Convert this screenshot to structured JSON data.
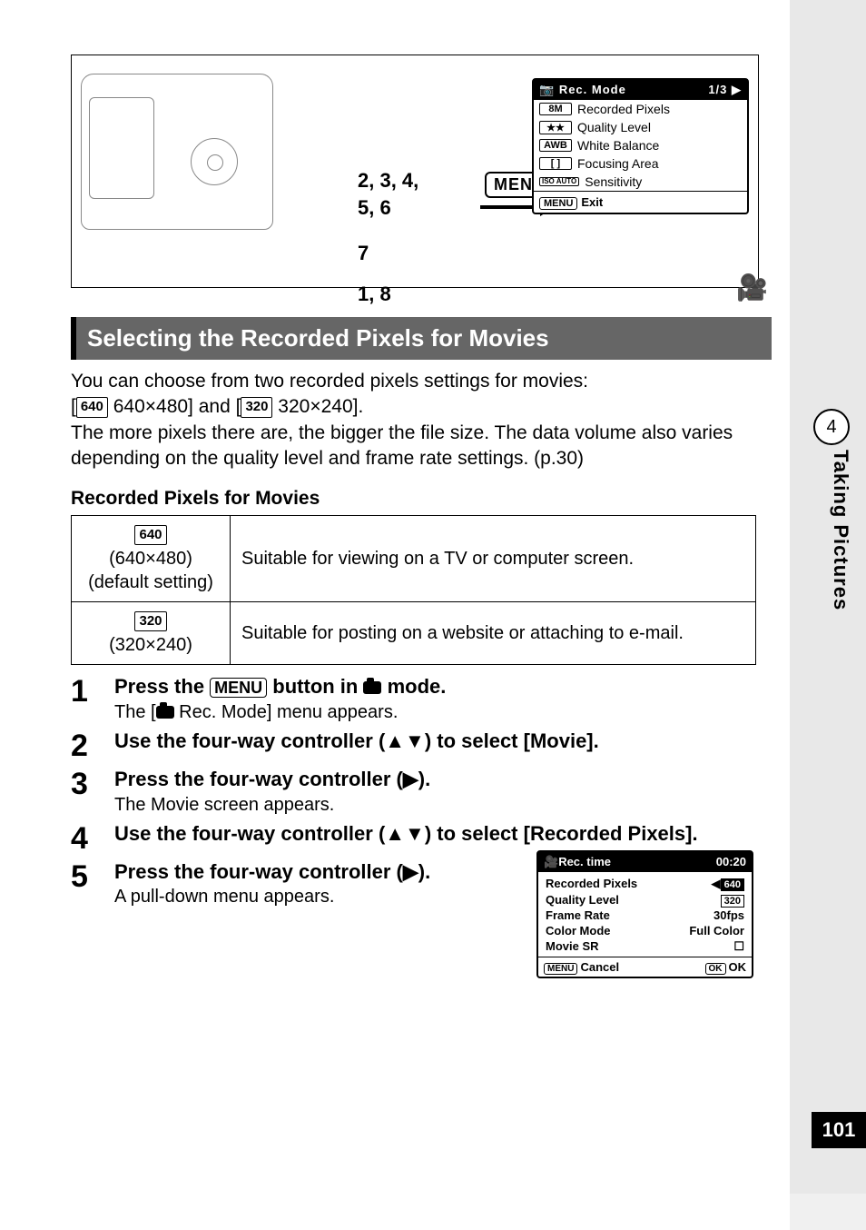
{
  "page_number": "101",
  "chapter_number": "4",
  "chapter_title": "Taking Pictures",
  "diagram": {
    "button_groups": {
      "dpad": "2, 3, 4,",
      "dpad2": "5, 6",
      "ok": "7",
      "menu": "1, 8"
    },
    "menu_button_label": "MENU"
  },
  "lcd_top": {
    "title_left": "Rec. Mode",
    "title_right": "1/3",
    "rows": [
      {
        "icon": "8M",
        "label": "Recorded Pixels"
      },
      {
        "icon": "★★",
        "label": "Quality Level"
      },
      {
        "icon": "AWB",
        "label": "White Balance"
      },
      {
        "icon": "[ ]",
        "label": "Focusing Area"
      },
      {
        "icon": "ISO AUTO",
        "label": "Sensitivity"
      }
    ],
    "footer_btn": "MENU",
    "footer_label": "Exit"
  },
  "section_title": "Selecting the Recorded Pixels for Movies",
  "intro_line1": "You can choose from two recorded pixels settings for movies:",
  "intro_pix640_box": "640",
  "intro_pix640_text": " 640×480] and [",
  "intro_pix320_box": "320",
  "intro_pix320_text": " 320×240].",
  "intro_line3": "The more pixels there are, the bigger the file size. The data volume also varies depending on the quality level and frame rate settings. (p.30)",
  "table_heading": "Recorded Pixels for Movies",
  "table_rows": [
    {
      "box": "640",
      "size": "(640×480)",
      "note": "(default setting)",
      "desc": "Suitable for viewing on a TV or computer screen."
    },
    {
      "box": "320",
      "size": "(320×240)",
      "note": "",
      "desc": "Suitable for posting on a website or attaching to e-mail."
    }
  ],
  "steps": [
    {
      "num": "1",
      "title_pre": "Press the ",
      "title_btn": "MENU",
      "title_post": " button in ",
      "title_end": " mode.",
      "desc_pre": "The [",
      "desc_post": " Rec. Mode] menu appears."
    },
    {
      "num": "2",
      "title": "Use the four-way controller (▲▼) to select [Movie].",
      "desc": ""
    },
    {
      "num": "3",
      "title": "Press the four-way controller (▶).",
      "desc": "The Movie screen appears."
    },
    {
      "num": "4",
      "title": "Use the four-way controller (▲▼) to select [Recorded Pixels].",
      "desc": ""
    },
    {
      "num": "5",
      "title": "Press the four-way controller (▶).",
      "desc": "A pull-down menu appears."
    }
  ],
  "lcd_bottom": {
    "title_left": "Rec. time",
    "title_right": "00:20",
    "rows": [
      {
        "label": "Recorded Pixels",
        "val_box1": "640",
        "val_box2": "320"
      },
      {
        "label": "Quality Level",
        "val": ""
      },
      {
        "label": "Frame Rate",
        "val": "30fps"
      },
      {
        "label": "Color Mode",
        "val": "Full Color"
      },
      {
        "label": "Movie SR",
        "val": "☐"
      }
    ],
    "footer_left_btn": "MENU",
    "footer_left": "Cancel",
    "footer_right_btn": "OK",
    "footer_right": "OK"
  }
}
